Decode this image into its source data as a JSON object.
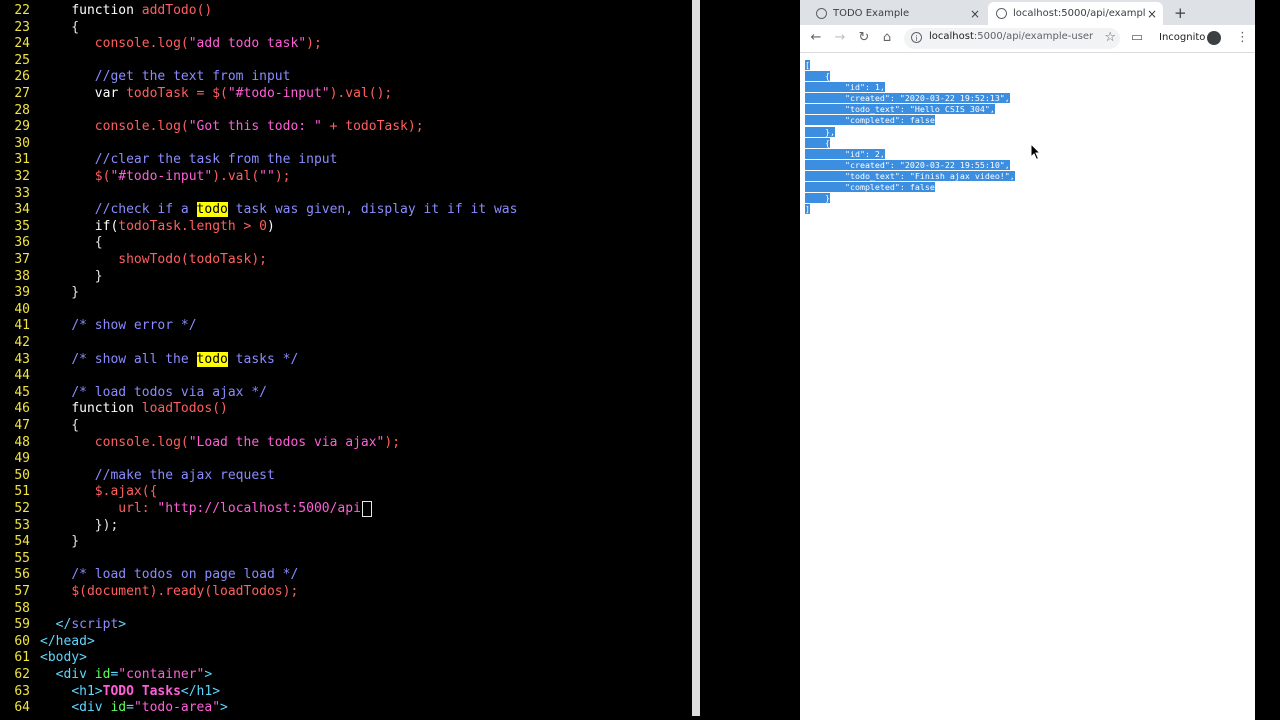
{
  "editor": {
    "lines": [
      {
        "n": "22",
        "tokens": [
          [
            "p",
            "    "
          ],
          [
            "kw",
            "function "
          ],
          [
            "fn",
            "addTodo"
          ],
          [
            "fn",
            "()"
          ]
        ]
      },
      {
        "n": "23",
        "tokens": [
          [
            "p",
            "    {"
          ]
        ]
      },
      {
        "n": "24",
        "tokens": [
          [
            "p",
            "       "
          ],
          [
            "fn",
            "console.log("
          ],
          [
            "str",
            "\"add todo task\""
          ],
          [
            "fn",
            ");"
          ]
        ]
      },
      {
        "n": "25",
        "tokens": []
      },
      {
        "n": "26",
        "tokens": [
          [
            "p",
            "       "
          ],
          [
            "cm",
            "//get the text from input"
          ]
        ]
      },
      {
        "n": "27",
        "tokens": [
          [
            "p",
            "       "
          ],
          [
            "kw",
            "var "
          ],
          [
            "id",
            "todoTask = $("
          ],
          [
            "str",
            "\"#todo-input\""
          ],
          [
            "id",
            ").val();"
          ]
        ]
      },
      {
        "n": "28",
        "tokens": []
      },
      {
        "n": "29",
        "tokens": [
          [
            "p",
            "       "
          ],
          [
            "fn",
            "console.log("
          ],
          [
            "str",
            "\"Got this todo: \""
          ],
          [
            "id",
            " + todoTask);"
          ]
        ]
      },
      {
        "n": "30",
        "tokens": []
      },
      {
        "n": "31",
        "tokens": [
          [
            "p",
            "       "
          ],
          [
            "cm",
            "//clear the task from the input"
          ]
        ]
      },
      {
        "n": "32",
        "tokens": [
          [
            "p",
            "       "
          ],
          [
            "id",
            "$("
          ],
          [
            "str",
            "\"#todo-input\""
          ],
          [
            "id",
            ").val("
          ],
          [
            "str",
            "\"\""
          ],
          [
            "id",
            ");"
          ]
        ]
      },
      {
        "n": "33",
        "tokens": []
      },
      {
        "n": "34",
        "tokens": [
          [
            "p",
            "       "
          ],
          [
            "cm",
            "//check if a "
          ],
          [
            "hl",
            "todo"
          ],
          [
            "cm",
            " task was given, display it if it was"
          ]
        ]
      },
      {
        "n": "35",
        "tokens": [
          [
            "p",
            "       "
          ],
          [
            "kw",
            "if("
          ],
          [
            "id",
            "todoTask.length > 0"
          ],
          [
            "kw",
            ")"
          ]
        ]
      },
      {
        "n": "36",
        "tokens": [
          [
            "p",
            "       {"
          ]
        ]
      },
      {
        "n": "37",
        "tokens": [
          [
            "p",
            "          "
          ],
          [
            "fn",
            "showTodo(todoTask);"
          ]
        ]
      },
      {
        "n": "38",
        "tokens": [
          [
            "p",
            "       }"
          ]
        ]
      },
      {
        "n": "39",
        "tokens": [
          [
            "p",
            "    }"
          ]
        ]
      },
      {
        "n": "40",
        "tokens": []
      },
      {
        "n": "41",
        "tokens": [
          [
            "p",
            "    "
          ],
          [
            "cm",
            "/* show error */"
          ]
        ]
      },
      {
        "n": "42",
        "tokens": []
      },
      {
        "n": "43",
        "tokens": [
          [
            "p",
            "    "
          ],
          [
            "cm",
            "/* show all the "
          ],
          [
            "hl",
            "todo"
          ],
          [
            "cm",
            " tasks */"
          ]
        ]
      },
      {
        "n": "44",
        "tokens": []
      },
      {
        "n": "45",
        "tokens": [
          [
            "p",
            "    "
          ],
          [
            "cm",
            "/* load todos via ajax */"
          ]
        ]
      },
      {
        "n": "46",
        "tokens": [
          [
            "p",
            "    "
          ],
          [
            "kw",
            "function "
          ],
          [
            "fn",
            "loadTodos"
          ],
          [
            "fn",
            "()"
          ]
        ]
      },
      {
        "n": "47",
        "tokens": [
          [
            "p",
            "    {"
          ]
        ]
      },
      {
        "n": "48",
        "tokens": [
          [
            "p",
            "       "
          ],
          [
            "fn",
            "console.log("
          ],
          [
            "str",
            "\"Load the todos via ajax\""
          ],
          [
            "fn",
            ");"
          ]
        ]
      },
      {
        "n": "49",
        "tokens": []
      },
      {
        "n": "50",
        "tokens": [
          [
            "p",
            "       "
          ],
          [
            "cm",
            "//make the ajax request"
          ]
        ]
      },
      {
        "n": "51",
        "tokens": [
          [
            "p",
            "       "
          ],
          [
            "id",
            "$.ajax({"
          ]
        ]
      },
      {
        "n": "52",
        "tokens": [
          [
            "p",
            "          "
          ],
          [
            "id",
            "url: "
          ],
          [
            "str",
            "\"http://localhost:5000/api"
          ],
          [
            "cursor",
            ""
          ]
        ]
      },
      {
        "n": "53",
        "tokens": [
          [
            "p",
            "       "
          ],
          [
            "p",
            "});"
          ]
        ]
      },
      {
        "n": "54",
        "tokens": [
          [
            "p",
            "    }"
          ]
        ]
      },
      {
        "n": "55",
        "tokens": []
      },
      {
        "n": "56",
        "tokens": [
          [
            "p",
            "    "
          ],
          [
            "cm",
            "/* load todos on page load */"
          ]
        ]
      },
      {
        "n": "57",
        "tokens": [
          [
            "p",
            "    "
          ],
          [
            "id",
            "$(document).ready(loadTodos);"
          ]
        ]
      },
      {
        "n": "58",
        "tokens": []
      },
      {
        "n": "59",
        "tokens": [
          [
            "p",
            "  "
          ],
          [
            "tag",
            "</"
          ],
          [
            "tagi",
            "script"
          ],
          [
            "tag",
            ">"
          ]
        ]
      },
      {
        "n": "60",
        "tokens": [
          [
            "tag",
            "</head>"
          ]
        ]
      },
      {
        "n": "61",
        "tokens": [
          [
            "tag",
            "<body>"
          ]
        ]
      },
      {
        "n": "62",
        "tokens": [
          [
            "p",
            "  "
          ],
          [
            "tag",
            "<div "
          ],
          [
            "attr",
            "id"
          ],
          [
            "tag",
            "="
          ],
          [
            "str",
            "\"container\""
          ],
          [
            "tag",
            ">"
          ]
        ]
      },
      {
        "n": "63",
        "tokens": [
          [
            "p",
            "    "
          ],
          [
            "tag",
            "<h1>"
          ],
          [
            "bold",
            "TODO Tasks"
          ],
          [
            "tag",
            "</h1>"
          ]
        ]
      },
      {
        "n": "64",
        "tokens": [
          [
            "p",
            "    "
          ],
          [
            "tag",
            "<div "
          ],
          [
            "attr",
            "id"
          ],
          [
            "tag",
            "="
          ],
          [
            "str",
            "\"todo-area\""
          ],
          [
            "tag",
            ">"
          ]
        ]
      }
    ]
  },
  "browser": {
    "tabs": [
      {
        "title": "TODO Example",
        "close": "×"
      },
      {
        "title": "localhost:5000/api/example-user",
        "close": "×"
      }
    ],
    "new_tab": "+",
    "url_host": "localhost",
    "url_rest": ":5000/api/example-user",
    "incognito_label": "Incognito",
    "json_lines": [
      "[",
      "    {",
      "        \"id\": 1,",
      "        \"created\": \"2020-03-22 19:52:13\",",
      "        \"todo_text\": \"Hello CSIS 304\",",
      "        \"completed\": false",
      "    },",
      "    {",
      "        \"id\": 2,",
      "        \"created\": \"2020-03-22 19:55:10\",",
      "        \"todo_text\": \"Finish ajax video!\",",
      "        \"completed\": false",
      "    }",
      "]"
    ]
  }
}
